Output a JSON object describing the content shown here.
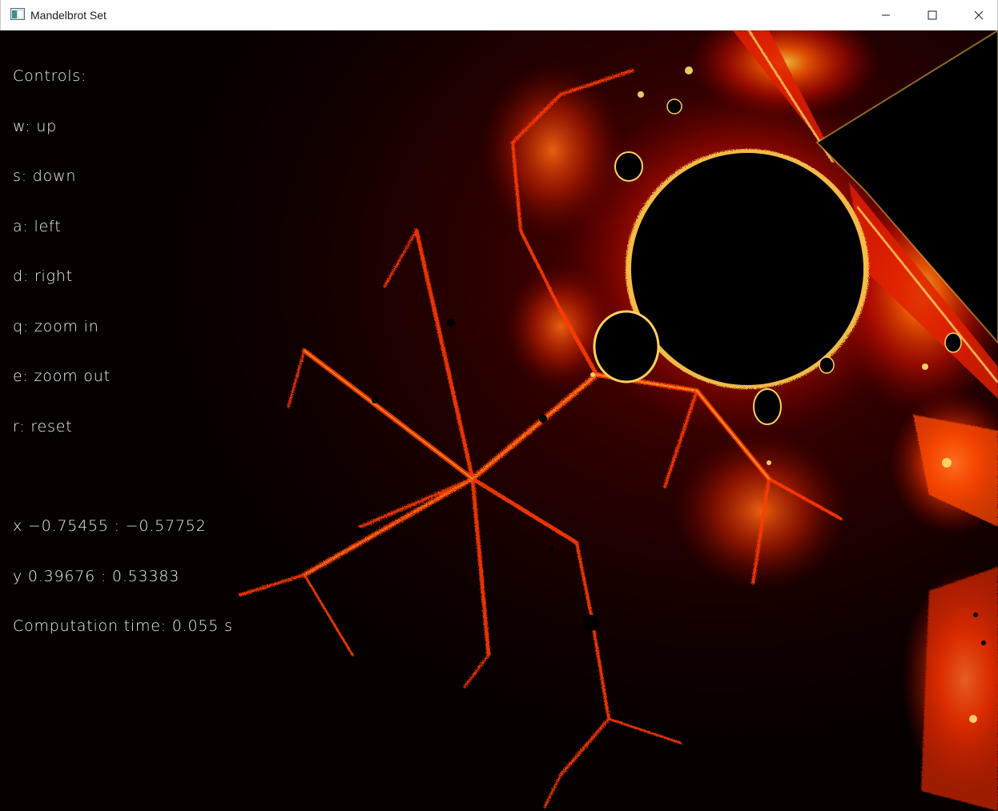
{
  "window": {
    "title": "Mandelbrot Set",
    "icons": {
      "app": "app-window-icon",
      "minimize": "minimize-icon",
      "maximize": "maximize-icon",
      "close": "close-icon"
    }
  },
  "hud": {
    "controls_header": "Controls:",
    "controls": [
      "w: up",
      "s: down",
      "a: left",
      "d: right",
      "q: zoom in",
      "e: zoom out",
      "r: reset"
    ],
    "x_range": "x −0.75455 : −0.57752",
    "y_range": "y 0.39676 : 0.53383",
    "computation_time": "Computation time: 0.055 s"
  },
  "colors": {
    "set_interior": "#000000",
    "glow_core": "#ffe680",
    "glow_mid": "#ff5a00",
    "glow_outer": "#c80000",
    "background_dark": "#0a0000",
    "hud_text": "#f2f2f2"
  }
}
